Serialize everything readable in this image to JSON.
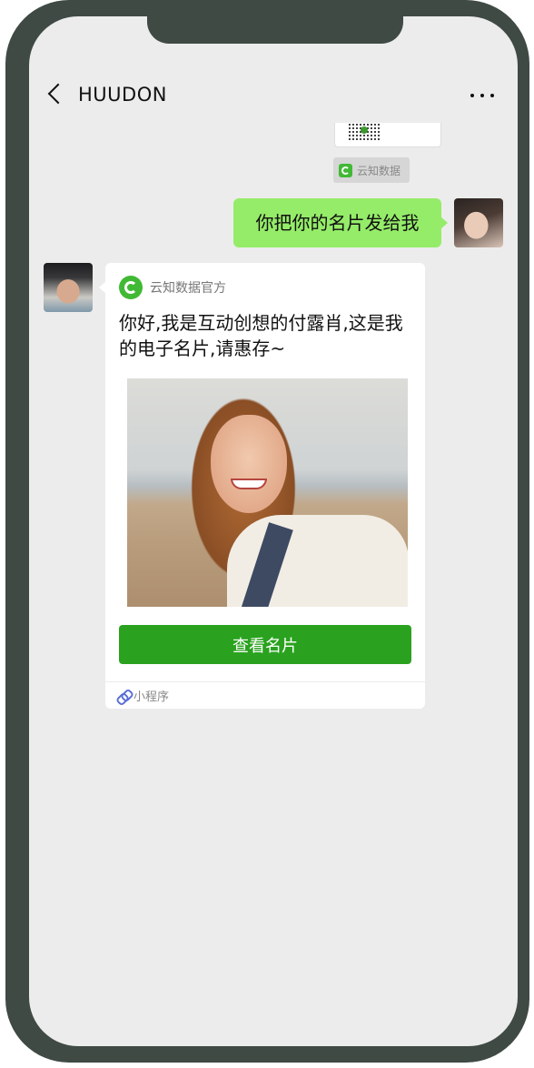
{
  "header": {
    "title": "HUUDON"
  },
  "messages": {
    "prev_card_source": "云知数据",
    "outgoing_text": "你把你的名片发给我"
  },
  "card": {
    "source_name": "云知数据官方",
    "text": "你好,我是互动创想的付露肖,这是我的电子名片,请惠存~",
    "button_label": "查看名片",
    "footer_label": "小程序"
  },
  "colors": {
    "frame": "#3f4a44",
    "chat_background": "#ececec",
    "outgoing_bubble": "#95ec69",
    "button_green": "#2aa21f",
    "logo_green": "#41b935"
  },
  "icons": {
    "back": "chevron-left-icon",
    "more": "more-horizontal-icon",
    "card_logo": "yunzhi-logo-icon",
    "mini_program": "link-icon"
  }
}
